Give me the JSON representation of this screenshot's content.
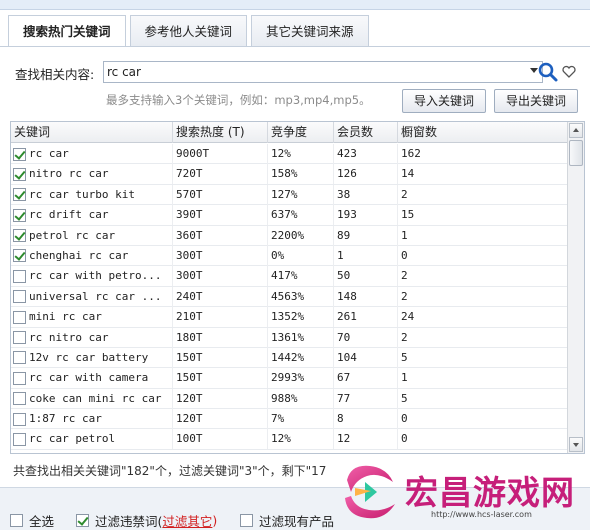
{
  "tabs": [
    {
      "label": "搜索热门关键词",
      "active": true
    },
    {
      "label": "参考他人关键词",
      "active": false
    },
    {
      "label": "其它关键词来源",
      "active": false
    }
  ],
  "search": {
    "label": "查找相关内容:",
    "value": "rc car",
    "hint": "最多支持输入3个关键词，例如：mp3,mp4,mp5。",
    "import_label": "导入关键词",
    "export_label": "导出关键词"
  },
  "table": {
    "columns": [
      "关键词",
      "搜索热度 (T)",
      "竞争度",
      "会员数",
      "橱窗数"
    ],
    "rows": [
      {
        "checked": true,
        "keyword": "rc car",
        "heat": "9000T",
        "competition": "12%",
        "members": "423",
        "showcase": "162"
      },
      {
        "checked": true,
        "keyword": "nitro rc car",
        "heat": "720T",
        "competition": "158%",
        "members": "126",
        "showcase": "14"
      },
      {
        "checked": true,
        "keyword": "rc car turbo kit",
        "heat": "570T",
        "competition": "127%",
        "members": "38",
        "showcase": "2"
      },
      {
        "checked": true,
        "keyword": "rc drift car",
        "heat": "390T",
        "competition": "637%",
        "members": "193",
        "showcase": "15"
      },
      {
        "checked": true,
        "keyword": "petrol rc car",
        "heat": "360T",
        "competition": "2200%",
        "members": "89",
        "showcase": "1"
      },
      {
        "checked": true,
        "keyword": "chenghai rc car",
        "heat": "300T",
        "competition": "0%",
        "members": "1",
        "showcase": "0"
      },
      {
        "checked": false,
        "keyword": "rc car with petro...",
        "heat": "300T",
        "competition": "417%",
        "members": "50",
        "showcase": "2"
      },
      {
        "checked": false,
        "keyword": "universal rc car ...",
        "heat": "240T",
        "competition": "4563%",
        "members": "148",
        "showcase": "2"
      },
      {
        "checked": false,
        "keyword": "mini rc car",
        "heat": "210T",
        "competition": "1352%",
        "members": "261",
        "showcase": "24"
      },
      {
        "checked": false,
        "keyword": "rc nitro car",
        "heat": "180T",
        "competition": "1361%",
        "members": "70",
        "showcase": "2"
      },
      {
        "checked": false,
        "keyword": "12v rc car battery",
        "heat": "150T",
        "competition": "1442%",
        "members": "104",
        "showcase": "5"
      },
      {
        "checked": false,
        "keyword": "rc car with camera",
        "heat": "150T",
        "competition": "2993%",
        "members": "67",
        "showcase": "1"
      },
      {
        "checked": false,
        "keyword": "coke can mini rc car",
        "heat": "120T",
        "competition": "988%",
        "members": "77",
        "showcase": "5"
      },
      {
        "checked": false,
        "keyword": "1:87 rc car",
        "heat": "120T",
        "competition": "7%",
        "members": "8",
        "showcase": "0"
      },
      {
        "checked": false,
        "keyword": "rc car petrol",
        "heat": "100T",
        "competition": "12%",
        "members": "12",
        "showcase": "0"
      }
    ]
  },
  "summary": "共查找出相关关键词\"182\"个，过滤关键词\"3\"个，剩下\"17",
  "bottom": {
    "select_all": "全选",
    "filter_banned": "过滤违禁词(",
    "filter_other_link": "过滤其它",
    "filter_close": ")",
    "filter_existing": "过滤现有产品",
    "select_all_checked": false,
    "filter_banned_checked": true,
    "filter_existing_checked": false
  },
  "watermark": {
    "title": "宏昌游戏网",
    "url": "http://www.hcs-laser.com"
  }
}
